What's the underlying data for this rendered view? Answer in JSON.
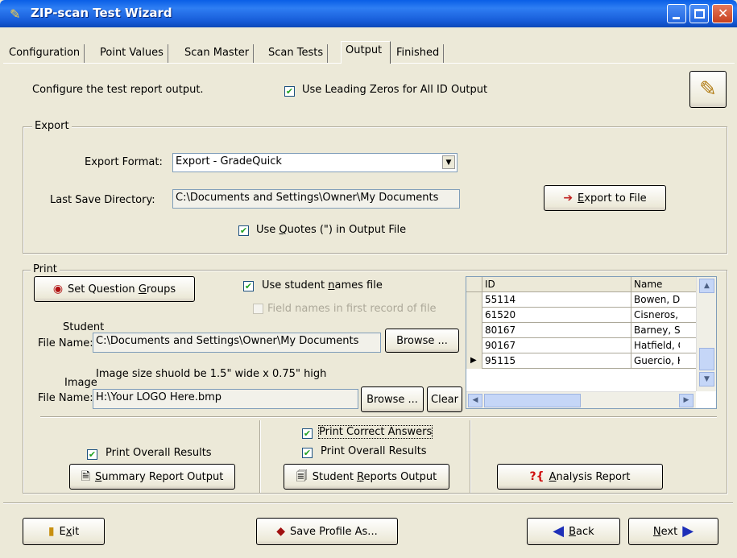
{
  "window": {
    "title": "ZIP-scan Test Wizard"
  },
  "tabs": [
    {
      "label": "Configuration"
    },
    {
      "label": "Point Values"
    },
    {
      "label": "Scan Master"
    },
    {
      "label": "Scan Tests"
    },
    {
      "label": "Output"
    },
    {
      "label": "Finished"
    }
  ],
  "header": {
    "instruction": "Configure the test report output.",
    "leading_zeros_label": "Use Leading Zeros for All ID Output",
    "leading_zeros_checked": true
  },
  "export": {
    "legend": "Export",
    "format_label": "Export Format:",
    "format_value": "Export - GradeQuick",
    "dir_label": "Last Save Directory:",
    "dir_value": "C:\\Documents and Settings\\Owner\\My Documents",
    "quotes_label_pre": "Use ",
    "quotes_label_u": "Q",
    "quotes_label_post": "uotes (\") in Output File",
    "quotes_checked": true,
    "export_button_u": "E",
    "export_button_rest": "xport to File"
  },
  "print": {
    "legend": "Print",
    "set_groups_pre": "Set Question ",
    "set_groups_u": "G",
    "set_groups_post": "roups",
    "use_names_pre": "Use student ",
    "use_names_u": "n",
    "use_names_post": "ames file",
    "use_names_checked": true,
    "field_names_label": "Field names in first record of file",
    "field_names_checked": false,
    "student_label_1": "Student",
    "student_label_2": "File Name:",
    "student_value": "C:\\Documents and Settings\\Owner\\My Documents",
    "browse_label": "Browse ...",
    "image_hint": "Image size shuold be 1.5\" wide x 0.75\" high",
    "image_label_1": "Image",
    "image_label_2": "File Name:",
    "image_value": "H:\\Your LOGO Here.bmp",
    "browse2_label": "Browse ...",
    "clear_label": "Clear",
    "grid": {
      "columns": [
        "ID",
        "Name"
      ],
      "rows": [
        {
          "id": "55114",
          "name": "Bowen, De"
        },
        {
          "id": "61520",
          "name": "Cisneros, A"
        },
        {
          "id": "80167",
          "name": "Barney, Sie"
        },
        {
          "id": "90167",
          "name": "Hatfield, Ch"
        },
        {
          "id": "95115",
          "name": "Guercio, Ki"
        }
      ],
      "current_row": 4
    },
    "summary_overall_label": "Print Overall Results",
    "summary_overall_checked": true,
    "summary_button_u": "S",
    "summary_button_rest": "ummary Report Output",
    "correct_answers_label": "Print Correct Answers",
    "correct_answers_checked": true,
    "student_overall_label": "Print Overall Results",
    "student_overall_checked": true,
    "student_button_pre": "Student ",
    "student_button_u": "R",
    "student_button_post": "eports Output",
    "analysis_button_u": "A",
    "analysis_button_rest": "nalysis Report"
  },
  "footer": {
    "exit_pre": "E",
    "exit_u": "x",
    "exit_post": "it",
    "save_profile": "Save Profile As...",
    "back_u": "B",
    "back_rest": "ack",
    "next_u": "N",
    "next_rest": "ext"
  },
  "colors": {
    "title_bar": "#0a5fe6",
    "window_bg": "#ece9d8",
    "nav_arrow": "#1d2fb8",
    "analysis_red": "#d01010"
  }
}
